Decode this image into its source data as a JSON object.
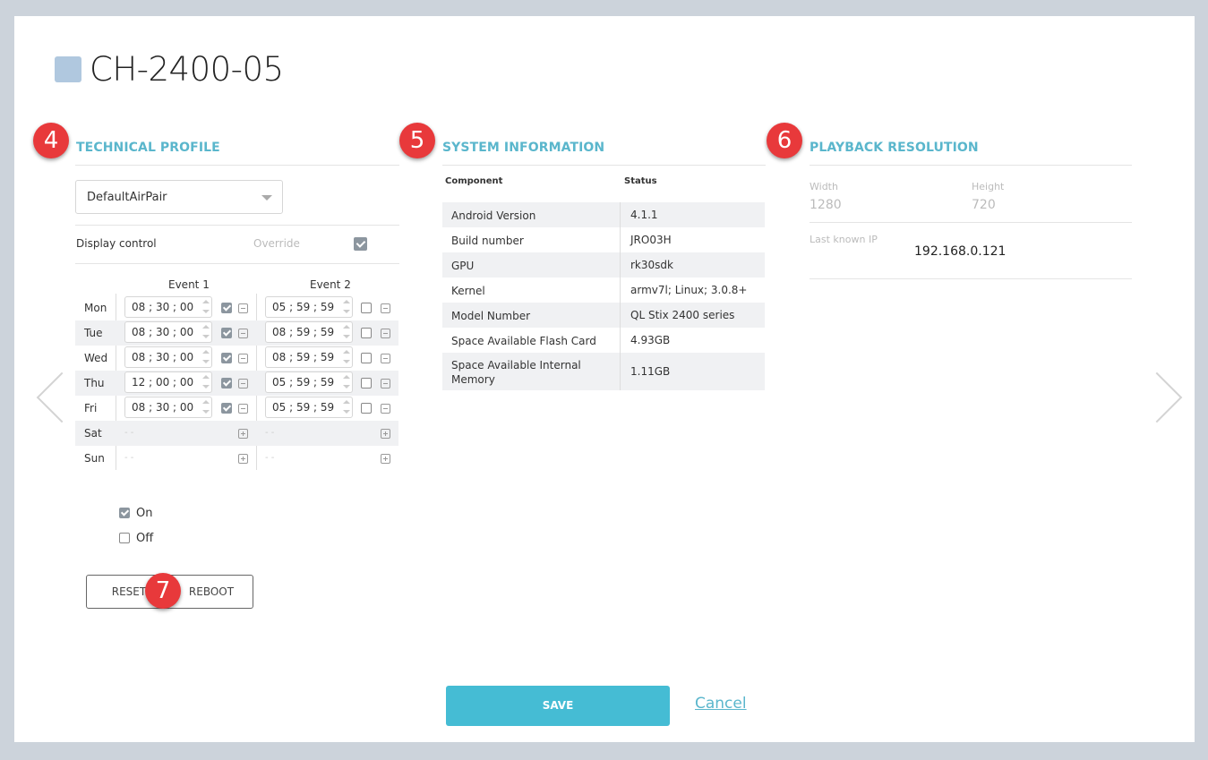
{
  "page_title": "CH-2400-05",
  "badges": [
    "4",
    "5",
    "6",
    "7"
  ],
  "technical_profile": {
    "title": "TECHNICAL PROFILE",
    "profile_value": "DefaultAirPair",
    "display_control_label": "Display control",
    "override_label": "Override",
    "override_checked": true,
    "event_headers": [
      "Event 1",
      "Event 2"
    ],
    "schedule": [
      {
        "day": "Mon",
        "event1": "08 ; 30 ; 00 AM",
        "event2": "05 ; 59 ; 59 PM",
        "e1_checked": true,
        "e2_checked": false
      },
      {
        "day": "Tue",
        "event1": "08 ; 30 ; 00 AM",
        "event2": "08 ; 59 ; 59 PM",
        "e1_checked": true,
        "e2_checked": false
      },
      {
        "day": "Wed",
        "event1": "08 ; 30 ; 00 AM",
        "event2": "08 ; 59 ; 59 PM",
        "e1_checked": true,
        "e2_checked": false
      },
      {
        "day": "Thu",
        "event1": "12 ; 00 ; 00 AM",
        "event2": "05 ; 59 ; 59 PM",
        "e1_checked": true,
        "e2_checked": false
      },
      {
        "day": "Fri",
        "event1": "08 ; 30 ; 00 AM",
        "event2": "05 ; 59 ; 59 PM",
        "e1_checked": true,
        "e2_checked": false
      },
      {
        "day": "Sat",
        "event1": "- -",
        "event2": "- -"
      },
      {
        "day": "Sun",
        "event1": "- -",
        "event2": "- -"
      }
    ],
    "on_label": "On",
    "off_label": "Off",
    "on_checked": true,
    "off_checked": false,
    "reset_label": "RESET",
    "reboot_label": "REBOOT"
  },
  "system_information": {
    "title": "SYSTEM INFORMATION",
    "col_component": "Component",
    "col_status": "Status",
    "rows": [
      {
        "component": "Android Version",
        "status": "4.1.1"
      },
      {
        "component": "Build number",
        "status": "JRO03H"
      },
      {
        "component": "GPU",
        "status": "rk30sdk"
      },
      {
        "component": "Kernel",
        "status": "armv7l; Linux; 3.0.8+"
      },
      {
        "component": "Model Number",
        "status": "QL Stix 2400 series"
      },
      {
        "component": "Space Available Flash Card",
        "status": "4.93GB"
      },
      {
        "component": "Space Available Internal Memory",
        "status": "1.11GB"
      }
    ]
  },
  "playback_resolution": {
    "title": "PLAYBACK RESOLUTION",
    "width_label": "Width",
    "width_value": "1280",
    "height_label": "Height",
    "height_value": "720",
    "last_ip_label": "Last known IP",
    "last_ip_value": "192.168.0.121"
  },
  "footer": {
    "save_label": "SAVE",
    "cancel_label": "Cancel"
  }
}
